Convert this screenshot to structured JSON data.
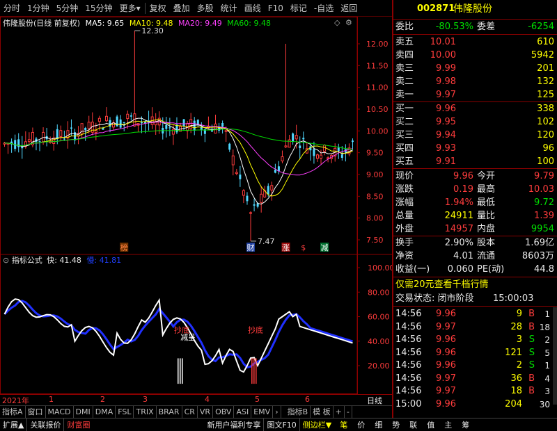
{
  "toolbar": {
    "items": [
      "分时",
      "1分钟",
      "5分钟",
      "15分钟",
      "更多",
      "复权",
      "叠加",
      "多股",
      "统计",
      "画线",
      "F10",
      "标记",
      "-自选",
      "返回"
    ],
    "more_caret": "▾"
  },
  "chart": {
    "stock_label": "伟隆股份(日线 前复权)",
    "ma5_label": "MA5: 9.65",
    "ma10_label": "MA10: 9.48",
    "ma20_label": "MA20: 9.49",
    "ma60_label": "MA60: 9.48",
    "price_ticks": [
      "12.00",
      "11.50",
      "11.00",
      "10.50",
      "10.00",
      "9.50",
      "9.00",
      "8.50",
      "8.00",
      "7.50"
    ],
    "high_label": "12.30",
    "low_label": "7.47",
    "events": [
      {
        "text": "榜",
        "color": "#ff8040",
        "bg": "#6a3000"
      },
      {
        "text": "财",
        "color": "#ffffff",
        "bg": "#2040a0"
      },
      {
        "text": "涨",
        "color": "#ffffff",
        "bg": "#a01010"
      },
      {
        "text": "$",
        "color": "#ff4040",
        "bg": "#000000"
      },
      {
        "text": "减",
        "color": "#ffffff",
        "bg": "#007030"
      }
    ],
    "colors": {
      "up": "#ff3c3c",
      "down": "#50d8ff",
      "ma5": "#ffffff",
      "ma10": "#ffff00",
      "ma20": "#ff40ff",
      "ma60": "#00e000",
      "grid": "#8b0000"
    }
  },
  "indicator": {
    "title": "指标公式",
    "fast_label": "快: 41.48",
    "slow_label": "慢: 41.81",
    "ticks": [
      "100.00",
      "80.00",
      "60.00",
      "40.00",
      "20.00"
    ],
    "signals": [
      "抄底",
      "抄底"
    ],
    "note": "减呈"
  },
  "xaxis": {
    "labels": [
      "2021年",
      "1",
      "2",
      "3",
      "4",
      "5",
      "6"
    ],
    "right": "日线"
  },
  "bottom_tabs": [
    "指标A",
    "窗口",
    "MACD",
    "DMI",
    "DMA",
    "FSL",
    "TRIX",
    "BRAR",
    "CR",
    "VR",
    "OBV",
    "ASI",
    "EMV",
    "›",
    "指标B",
    "模 板",
    "+",
    "-"
  ],
  "status_bar": {
    "left": [
      "扩展▲",
      "关联报价",
      "财富圈"
    ],
    "right": [
      "新用户福利专享",
      "图文F10",
      "侧边栏▼"
    ],
    "nav": [
      "笔",
      "价",
      "细",
      "势",
      "联",
      "值",
      "主",
      "筹"
    ]
  },
  "quote": {
    "code": "002871",
    "name": "伟隆股份",
    "weibi_label": "委比",
    "weibi": "-80.53%",
    "weicha_label": "委差",
    "weicha": "-6254",
    "asks": [
      {
        "label": "卖五",
        "price": "10.01",
        "vol": "610"
      },
      {
        "label": "卖四",
        "price": "10.00",
        "vol": "5942"
      },
      {
        "label": "卖三",
        "price": "9.99",
        "vol": "201"
      },
      {
        "label": "卖二",
        "price": "9.98",
        "vol": "132"
      },
      {
        "label": "卖一",
        "price": "9.97",
        "vol": "125"
      }
    ],
    "bids": [
      {
        "label": "买一",
        "price": "9.96",
        "vol": "338"
      },
      {
        "label": "买二",
        "price": "9.95",
        "vol": "102"
      },
      {
        "label": "买三",
        "price": "9.94",
        "vol": "120"
      },
      {
        "label": "买四",
        "price": "9.93",
        "vol": "96"
      },
      {
        "label": "买五",
        "price": "9.91",
        "vol": "100"
      }
    ],
    "stats": [
      {
        "l1": "现价",
        "v1": "9.96",
        "c1": "red",
        "l2": "今开",
        "v2": "9.79",
        "c2": "red"
      },
      {
        "l1": "涨跌",
        "v1": "0.19",
        "c1": "red",
        "l2": "最高",
        "v2": "10.03",
        "c2": "red"
      },
      {
        "l1": "涨幅",
        "v1": "1.94%",
        "c1": "red",
        "l2": "最低",
        "v2": "9.72",
        "c2": "grn"
      },
      {
        "l1": "总量",
        "v1": "24911",
        "c1": "yel",
        "l2": "量比",
        "v2": "1.39",
        "c2": "red"
      },
      {
        "l1": "外盘",
        "v1": "14957",
        "c1": "red",
        "l2": "内盘",
        "v2": "9954",
        "c2": "grn"
      }
    ],
    "fund": [
      {
        "l1": "换手",
        "v1": "2.90%",
        "l2": "股本",
        "v2": "1.69亿"
      },
      {
        "l1": "净资",
        "v1": "4.01",
        "l2": "流通",
        "v2": "8603万"
      },
      {
        "l1": "收益(一)",
        "v1": "0.060",
        "l2": "PE(动)",
        "v2": "44.8"
      }
    ],
    "promo": "仅需20元查看千档行情",
    "trade_status_label": "交易状态: 闭市阶段",
    "trade_time": "15:00:03",
    "ticks": [
      {
        "t": "14:56",
        "p": "9.96",
        "v": "9",
        "bs": "B",
        "n": "1"
      },
      {
        "t": "14:56",
        "p": "9.97",
        "v": "28",
        "bs": "B",
        "n": "18"
      },
      {
        "t": "14:56",
        "p": "9.96",
        "v": "3",
        "bs": "S",
        "n": "2"
      },
      {
        "t": "14:56",
        "p": "9.96",
        "v": "121",
        "bs": "S",
        "n": "5"
      },
      {
        "t": "14:56",
        "p": "9.96",
        "v": "2",
        "bs": "S",
        "n": "1"
      },
      {
        "t": "14:56",
        "p": "9.97",
        "v": "36",
        "bs": "B",
        "n": "4"
      },
      {
        "t": "14:56",
        "p": "9.97",
        "v": "18",
        "bs": "B",
        "n": "3"
      },
      {
        "t": "15:00",
        "p": "9.96",
        "v": "204",
        "bs": "",
        "n": "30"
      }
    ]
  }
}
